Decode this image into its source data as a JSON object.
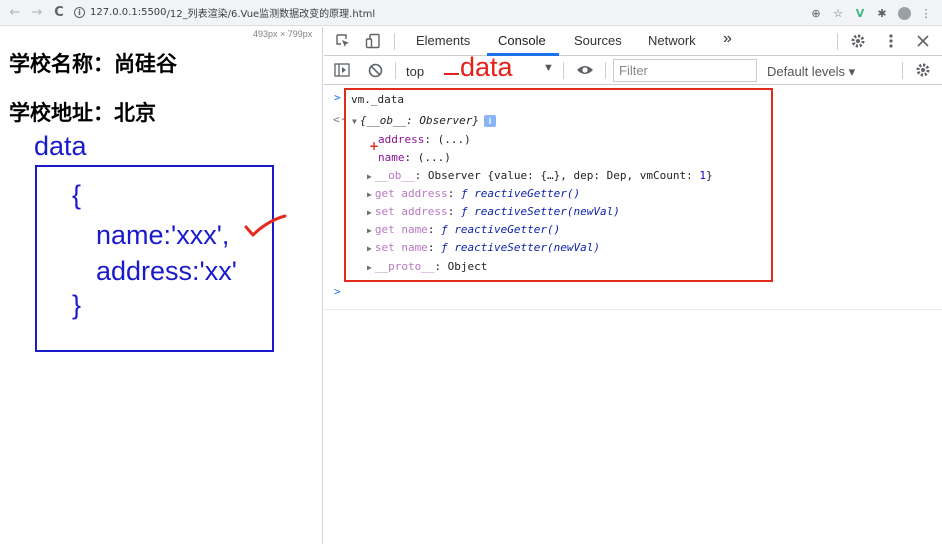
{
  "browser": {
    "nav": {
      "back": "←",
      "forward": "→",
      "reload": "C"
    },
    "url_host": "127.0.0.1:5500",
    "url_path": "/12_列表渲染/6.Vue监测数据改变的原理.html",
    "right_icons": [
      "⊕",
      "☆",
      "V",
      "✱",
      "●",
      "⋮"
    ]
  },
  "page": {
    "viewport_size": "493px × 799px",
    "school_name": "学校名称：尚硅谷",
    "school_address": "学校地址：北京",
    "annotation_data_label": "data",
    "code": {
      "open": "{",
      "line1": "name:'xxx',",
      "line2": "address:'xx'",
      "close": "}"
    }
  },
  "devtools": {
    "tabs": [
      "Elements",
      "Console",
      "Sources",
      "Network"
    ],
    "active_tab": "Console",
    "more_tabs": "»",
    "toolbar": {
      "context": "top",
      "filter_placeholder": "Filter",
      "levels": "Default levels ▾"
    },
    "annotation_data": "data",
    "console_lines": {
      "input": "vm._data",
      "obj_head": "{__ob__: Observer}",
      "address_key": "address",
      "address_val": ": (...)",
      "name_key": "name",
      "name_val": ": (...)",
      "ob_key": "__ob__",
      "ob_val": ": Observer {value: {…}, dep: Dep, vmCount: ",
      "ob_count": "1",
      "ob_close": "}",
      "get_addr_key": "get address",
      "get_addr_val": "reactiveGetter()",
      "set_addr_key": "set address",
      "set_addr_val": "reactiveSetter(newVal)",
      "get_name_key": "get name",
      "get_name_val": "reactiveGetter()",
      "set_name_key": "set name",
      "set_name_val": "reactiveSetter(newVal)",
      "proto_key": "__proto__",
      "proto_val": ": Object",
      "fn_symbol": "ƒ "
    },
    "colors": {
      "accent": "#1a73e8",
      "annotation_red": "#e22a1f",
      "annotation_blue": "#1a1acd"
    }
  }
}
